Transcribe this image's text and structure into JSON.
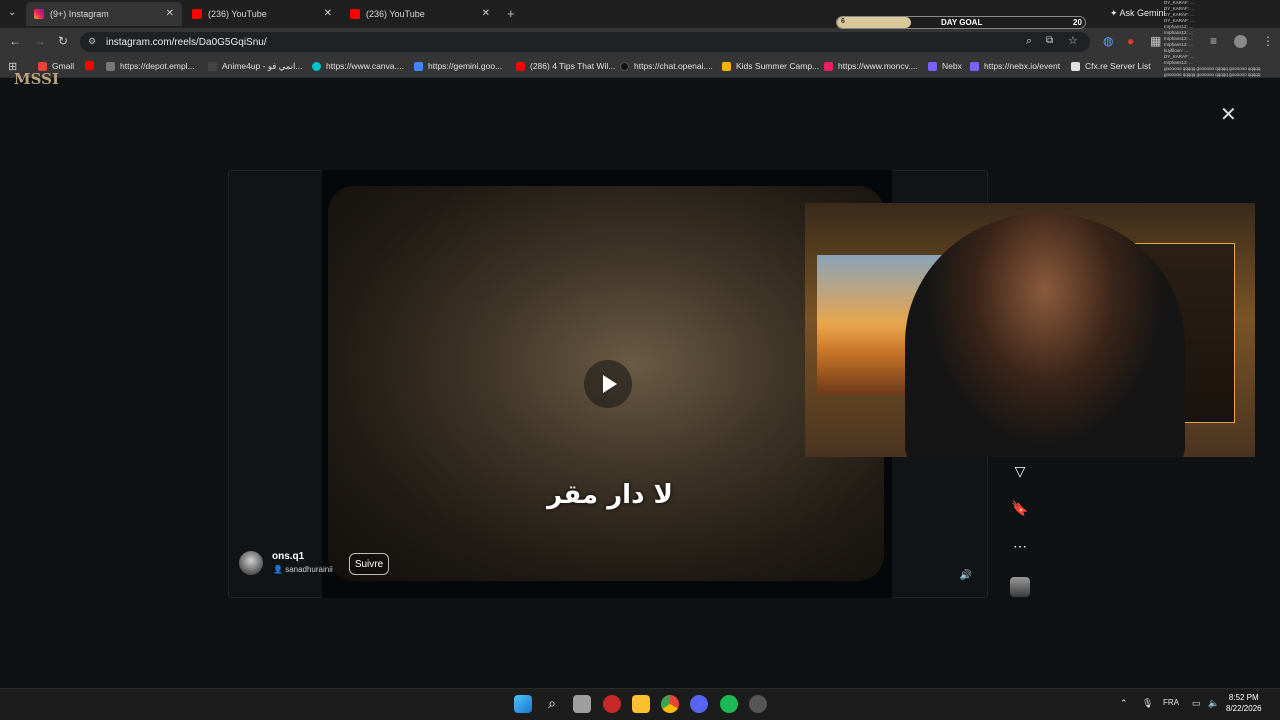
{
  "browser": {
    "tabs": [
      {
        "title": "(9+) Instagram",
        "icon": "instagram-icon",
        "active": true
      },
      {
        "title": "(236) YouTube",
        "icon": "youtube-icon",
        "active": false
      },
      {
        "title": "(236) YouTube",
        "icon": "youtube-icon",
        "active": false
      }
    ],
    "new_tab": "+",
    "tab_dropdown": "⌄",
    "url": "instagram.com/reels/Da0G5GqiSnu/",
    "ask_gemini": "Ask Gemini"
  },
  "bookmarks": [
    {
      "label": "Gmail",
      "icon": "gmail-icon",
      "color": "#ea4335"
    },
    {
      "label": "",
      "icon": "youtube-icon",
      "color": "#ff0000"
    },
    {
      "label": "https://depot.empl...",
      "icon": "page-icon",
      "color": "#777777"
    },
    {
      "label": "Anime4up - انمي فو...",
      "icon": "page-icon",
      "color": "#444444"
    },
    {
      "label": "https://www.canva....",
      "icon": "canva-icon",
      "color": "#00c4cc"
    },
    {
      "label": "https://gemini.goo...",
      "icon": "gemini-icon",
      "color": "#4285f4"
    },
    {
      "label": "(286) 4 Tips That Wil...",
      "icon": "youtube-icon",
      "color": "#ff0000"
    },
    {
      "label": "https://chat.openai....",
      "icon": "openai-icon",
      "color": "#111111"
    },
    {
      "label": "Kids Summer Camp...",
      "icon": "page-icon",
      "color": "#f4b400"
    },
    {
      "label": "https://www.moncv....",
      "icon": "page-icon",
      "color": "#e91e63"
    },
    {
      "label": "Nebx",
      "icon": "nebx-icon",
      "color": "#7b61ff"
    },
    {
      "label": "https://nebx.io/event",
      "icon": "nebx-icon",
      "color": "#7b61ff"
    },
    {
      "label": "Cfx.re Server List",
      "icon": "cfx-icon",
      "color": "#e0e0e0"
    }
  ],
  "overlay": {
    "day_goal_label": "DAY GOAL",
    "day_goal_start": "6",
    "day_goal_target": "20",
    "day_goal_progress": 0.3,
    "chat_lines": [
      "DY_KARAF: ...",
      "DY_KARAF: ...",
      "DY_KARAF: ...",
      "DY_KARAF: ...",
      "mrphans12: ...",
      "mrphans12: ...",
      "mrphans12: ...",
      "mrphans12: ...",
      "kuyfiloon: ...",
      "DY_KARAF: ...",
      "mrphans12: ...",
      "goooooo qqqqq goooooo qqqqq goooooo qqqqq",
      "goooooo qqqqq goooooo qqqqq goooooo qqqqq",
      "goooooo qqqqq goooooo qqqqq goooooo qqqqq",
      "mrphans12: ...",
      "mrphans12: ...",
      "bnvedaooo: ...",
      "Graphicco: hahahahahah",
      "bnvedaooo: ...",
      "Fallia_R: goooooo qqqqq",
      "goooooo qqqqq goooooo qqqqq goooooo qqqqq",
      "goooooo qqqqq goooooo qqqqq goooooo qqqqq"
    ]
  },
  "reel": {
    "subtitle": "لا دار مقر",
    "author": "ons.q1",
    "audio": "sanadhurainii",
    "follow_label": "Suivre",
    "logo_text": "MSSI"
  },
  "system": {
    "time": "8:52 PM",
    "date": "8/22/2026",
    "language": "FRA"
  }
}
